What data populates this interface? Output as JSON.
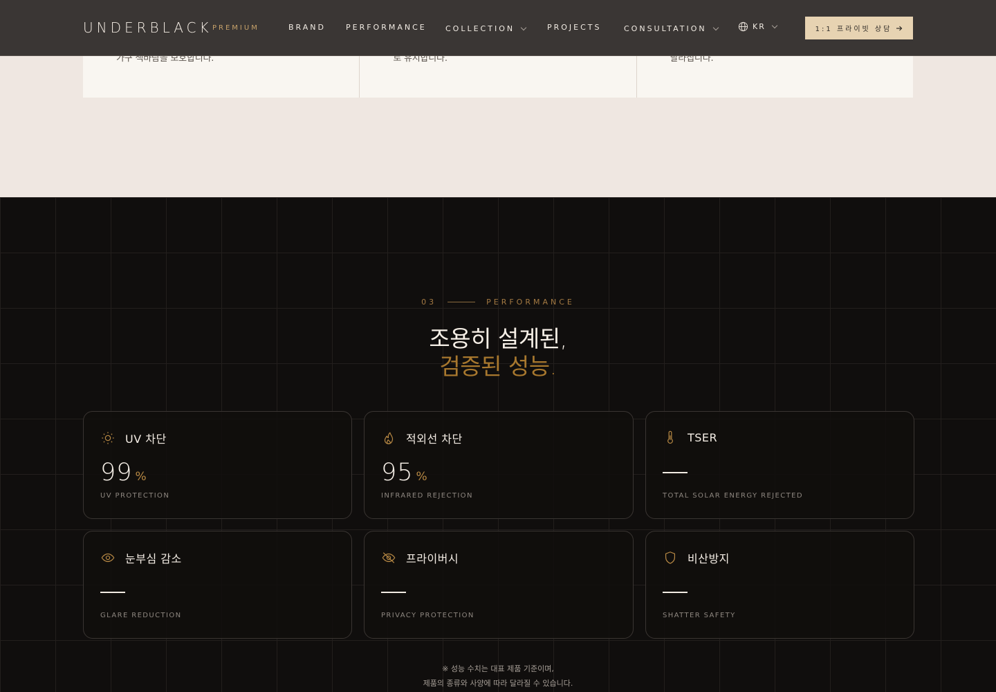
{
  "header": {
    "logo": "UNDERBLACK",
    "badge": "PREMIUM",
    "nav": [
      {
        "label": "BRAND",
        "has_dropdown": false
      },
      {
        "label": "PERFORMANCE",
        "has_dropdown": false
      },
      {
        "label": "COLLECTION",
        "has_dropdown": true
      },
      {
        "label": "PROJECTS",
        "has_dropdown": false
      },
      {
        "label": "CONSULTATION",
        "has_dropdown": true
      }
    ],
    "language": "KR",
    "cta_label": "1:1 프라이빗 상담",
    "cta_icon": "arrow-right-icon"
  },
  "features_partial": [
    {
      "text": "가구 색바람을 보호합니다."
    },
    {
      "text": "로 유지합니다."
    },
    {
      "text": "달라집니다."
    }
  ],
  "performance": {
    "number": "03",
    "eyebrow": "PERFORMANCE",
    "heading_line1": "조용히 설계된,",
    "heading_line2": "검증된 성능.",
    "cards": [
      {
        "icon": "sun-icon",
        "title": "UV 차단",
        "value": "99",
        "unit": "%",
        "subtitle": "UV PROTECTION"
      },
      {
        "icon": "flame-icon",
        "title": "적외선 차단",
        "value": "95",
        "unit": "%",
        "subtitle": "INFRARED REJECTION"
      },
      {
        "icon": "thermometer-icon",
        "title": "TSER",
        "value": "",
        "unit": "",
        "subtitle": "TOTAL SOLAR ENERGY REJECTED"
      },
      {
        "icon": "eye-icon",
        "title": "눈부심 감소",
        "value": "",
        "unit": "",
        "subtitle": "GLARE REDUCTION"
      },
      {
        "icon": "eye-off-icon",
        "title": "프라이버시",
        "value": "",
        "unit": "",
        "subtitle": "PRIVACY PROTECTION"
      },
      {
        "icon": "shield-icon",
        "title": "비산방지",
        "value": "",
        "unit": "",
        "subtitle": "SHATTER SAFETY"
      }
    ],
    "note_line1": "※ 성능 수치는 대표 제품 기준이며,",
    "note_line2": "제품의 종류와 사양에 따라 달라질 수 있습니다."
  },
  "colors": {
    "accent_gold": "#a8782e",
    "header_bg": "#3a3634",
    "cta_bg": "#e7d3b2",
    "dark_bg": "#100e0d",
    "light_bg": "#efe7e1"
  }
}
